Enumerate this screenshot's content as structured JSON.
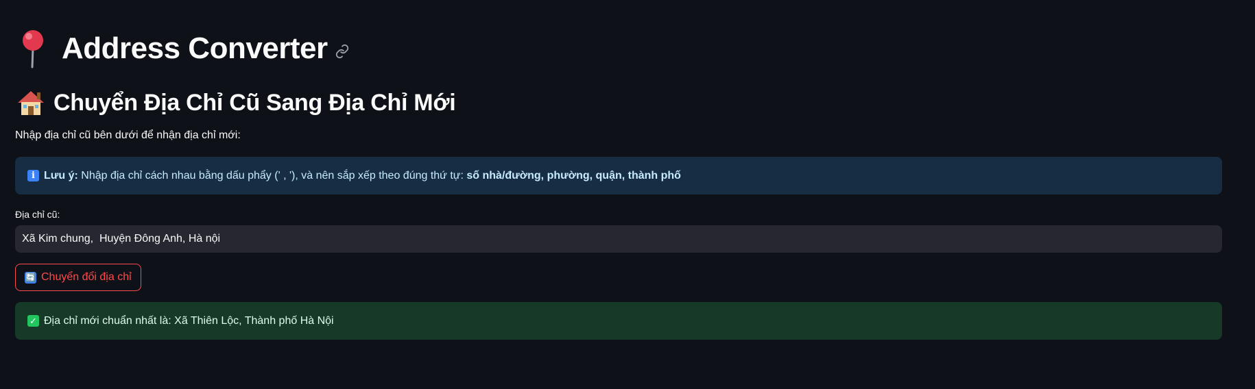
{
  "header": {
    "title": "Address Converter",
    "title_icon": "round-pushpin-icon",
    "anchor_icon": "link-icon"
  },
  "section": {
    "title": "Chuyển Địa Chỉ Cũ Sang Địa Chỉ Mới",
    "title_icon": "house-icon",
    "instruction": "Nhập địa chỉ cũ bên dưới để nhận địa chỉ mới:"
  },
  "info": {
    "icon": "info-icon",
    "icon_glyph": "i",
    "label": "Lưu ý:",
    "text": " Nhập địa chỉ cách nhau bằng dấu phẩy (' , '), và nên sắp xếp theo đúng thứ tự: ",
    "order": "số nhà/đường, phường, quận, thành phố"
  },
  "form": {
    "label": "Địa chỉ cũ:",
    "value": "Xã Kim chung,  Huyện Đông Anh, Hà nội",
    "button_icon": "refresh-icon",
    "button_icon_glyph": "🔄",
    "button_label": "Chuyển đổi địa chỉ"
  },
  "result": {
    "icon": "check-icon",
    "icon_glyph": "✓",
    "text": "Địa chỉ mới chuẩn nhất là: Xã Thiên Lộc, Thành phố Hà Nội"
  },
  "colors": {
    "background": "#0e1117",
    "info_bg": "#172d43",
    "success_bg": "#173928",
    "input_bg": "#262730",
    "accent_red": "#ff4b4b"
  }
}
